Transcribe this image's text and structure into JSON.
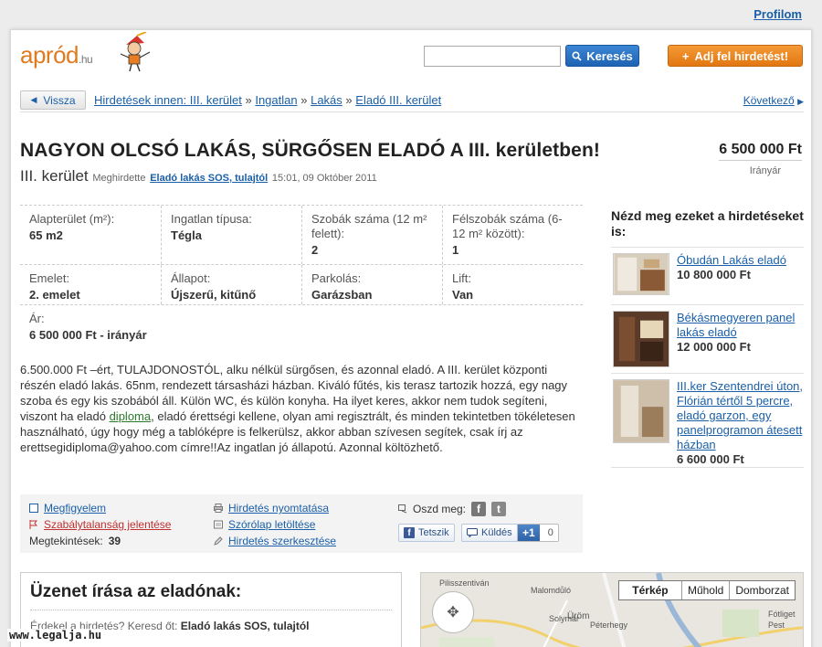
{
  "top_link": "Profilom",
  "header": {
    "logo_main": "apród",
    "logo_suffix": ".hu",
    "search_button": "Keresés",
    "post_button": "Adj fel hirdetést!"
  },
  "nav": {
    "back": "Vissza",
    "crumb_prefix": "Hirdetések innen: III. kerület",
    "crumb_1": "Ingatlan",
    "crumb_2": "Lakás",
    "crumb_3": "Eladó III. kerület",
    "sep": "»",
    "next": "Következő"
  },
  "listing": {
    "title": "NAGYON OLCSÓ LAKÁS, SÜRGŐSEN ELADÓ A III. kerületben!",
    "price": "6 500 000 Ft",
    "price_note": "Irányár",
    "district": "III. kerület",
    "posted_by_label": "Meghirdette",
    "seller": "Eladó lakás SOS, tulajtól",
    "posted_at": "15:01, 09 Október 2011"
  },
  "details": {
    "r1": [
      {
        "label": "Alapterület (m²):",
        "value": "65 m2"
      },
      {
        "label": "Ingatlan típusa:",
        "value": "Tégla"
      },
      {
        "label": "Szobák száma (12 m² felett):",
        "value": "2"
      },
      {
        "label": "Félszobák száma (6-12 m² között):",
        "value": "1"
      }
    ],
    "r2": [
      {
        "label": "Emelet:",
        "value": "2. emelet"
      },
      {
        "label": "Állapot:",
        "value": "Újszerű, kitűnő"
      },
      {
        "label": "Parkolás:",
        "value": "Garázsban"
      },
      {
        "label": "Lift:",
        "value": "Van"
      }
    ],
    "r3": [
      {
        "label": "Ár:",
        "value": "6 500 000 Ft - irányár"
      }
    ]
  },
  "description": {
    "part1": "6.500.000 Ft –ért, TULAJDONOSTÓL, alku nélkül sürgősen, és azonnal eladó. A III. kerület központi részén eladó lakás. 65nm, rendezett társasházi házban. Kiváló fűtés, kis terasz tartozik hozzá, egy nagy szoba és egy kis szobából áll. Külön WC, és külön konyha. Ha ilyet keres, akkor nem tudok segíteni, viszont ha eladó ",
    "link": "diploma",
    "part2": ", eladó érettségi kellene, olyan ami regisztrált, és minden tekintetben tökéletesen használható, úgy hogy még a tablóképre is felkerülsz, akkor abban szívesen segítek, csak írj az erettsegidiploma@yahoo.com címre!!Az ingatlan jó állapotú. Azonnal költözhető."
  },
  "actions": {
    "watch": "Megfigyelem",
    "report": "Szabálytalanság jelentése",
    "views_label": "Megtekintések:",
    "views": "39",
    "print": "Hirdetés nyomtatása",
    "flyer": "Szórólap letöltése",
    "edit": "Hirdetés szerkesztése",
    "share_label": "Oszd meg:",
    "like": "Tetszik",
    "send": "Küldés",
    "plus": "+1",
    "plus_count": "0"
  },
  "message": {
    "heading": "Üzenet írása az eladónak:",
    "question": "Érdekel a hirdetés? Keresd őt:",
    "seller": "Eladó lakás SOS, tulajtól"
  },
  "map": {
    "tabs": [
      "Térkép",
      "Műhold",
      "Domborzat"
    ],
    "labels": [
      "Pilisszentiván",
      "Solymár",
      "Üröm",
      "Péterhegy",
      "Fótliget",
      "Pest"
    ]
  },
  "sidebar": {
    "heading": "Nézd meg ezeket a hirdetéseket is:",
    "items": [
      {
        "title": "Óbudán Lakás eladó",
        "price": "10 800 000 Ft"
      },
      {
        "title": "Békásmegyeren panel lakás eladó",
        "price": "12 000 000 Ft"
      },
      {
        "title": "III.ker Szentendrei úton, Flórián tértől 5 percre, eladó garzon, egy panelprogramon átesett házban",
        "price": "6 600 000 Ft"
      }
    ]
  },
  "watermark": "www.legalja.hu"
}
